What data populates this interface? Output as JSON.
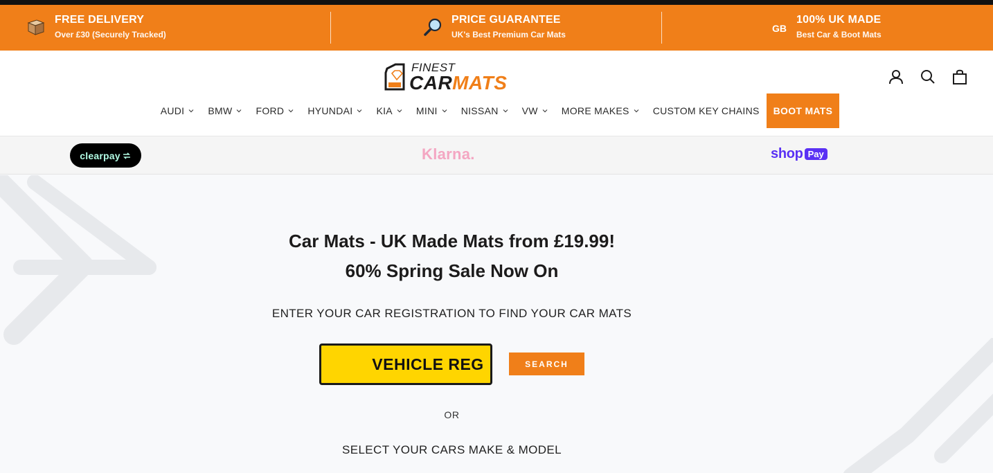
{
  "promo": [
    {
      "icon": "box-icon",
      "title": "FREE DELIVERY",
      "sub": "Over £30 (Securely Tracked)"
    },
    {
      "icon": "magnifier-icon",
      "title": "PRICE GUARANTEE",
      "sub": "UK's Best Premium Car Mats"
    },
    {
      "icon": "gb-icon",
      "icon_text": "GB",
      "title": "100% UK MADE",
      "sub": "Best Car & Boot Mats"
    }
  ],
  "logo": {
    "top": "FINEST",
    "car": "CAR",
    "mats": "MATS"
  },
  "nav": [
    {
      "label": "AUDI"
    },
    {
      "label": "BMW"
    },
    {
      "label": "FORD"
    },
    {
      "label": "HYUNDAI"
    },
    {
      "label": "KIA"
    },
    {
      "label": "MINI"
    },
    {
      "label": "NISSAN"
    },
    {
      "label": "VW"
    },
    {
      "label": "MORE MAKES"
    },
    {
      "label": "CUSTOM KEY CHAINS"
    },
    {
      "label": "BOOT MATS"
    }
  ],
  "payments": {
    "clearpay": "clearpay",
    "klarna": "Klarna.",
    "shop": "shop",
    "pay": "Pay"
  },
  "hero": {
    "headline_1": "Car Mats - UK Made Mats from £19.99!",
    "headline_2": "60% Spring Sale Now On",
    "reg_prompt": "ENTER YOUR CAR REGISTRATION TO FIND YOUR CAR MATS",
    "reg_placeholder": "VEHICLE REG",
    "search_label": "SEARCH",
    "or_label": "OR",
    "select_label": "SELECT YOUR CARS MAKE & MODEL"
  },
  "colors": {
    "accent": "#f07f19",
    "plate_yellow": "#ffd500",
    "plate_blue": "#1440a0"
  }
}
